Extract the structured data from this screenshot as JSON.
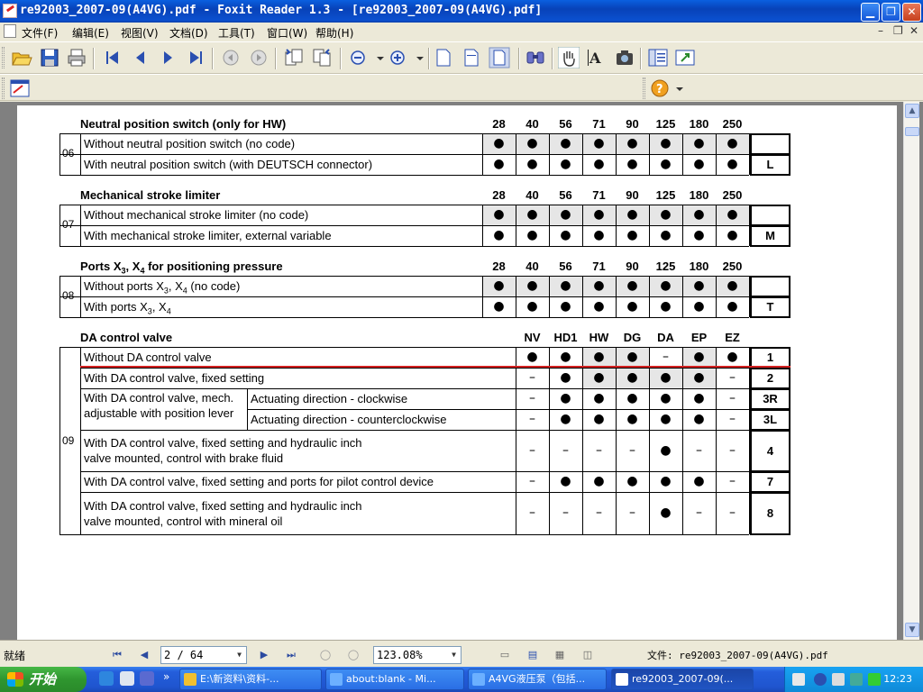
{
  "window": {
    "title": "re92003_2007-09(A4VG).pdf - Foxit Reader 1.3 - [re92003_2007-09(A4VG).pdf]",
    "minimize_glyph": "▁",
    "maximize_glyph": "❐",
    "close_glyph": "✕"
  },
  "menu": {
    "items": [
      "文件(F)",
      "编辑(E)",
      "视图(V)",
      "文档(D)",
      "工具(T)",
      "窗口(W)",
      "帮助(H)"
    ],
    "mdi_buttons": [
      "–",
      "❐",
      "✕"
    ]
  },
  "toolbar": {
    "icons": [
      "open-icon",
      "save-icon",
      "print-icon",
      "first-page-icon",
      "prev-page-icon",
      "next-page-icon",
      "last-page-icon",
      "back-icon",
      "forward-icon",
      "rotate-left-icon",
      "rotate-right-icon",
      "zoom-out-icon",
      "zoom-in-icon",
      "single-page-icon",
      "fit-width-icon",
      "fit-page-icon",
      "find-icon",
      "hand-icon",
      "select-text-icon",
      "snapshot-icon",
      "bookmarks-icon",
      "fullscreen-icon"
    ],
    "help_icon": "help-icon"
  },
  "document": {
    "size_headers": [
      "28",
      "40",
      "56",
      "71",
      "90",
      "125",
      "180",
      "250"
    ],
    "sections": [
      {
        "number": "06",
        "title": "Neutral position switch (only for HW)",
        "rows": [
          {
            "label": "Without neutral position switch (no code)",
            "cells": [
              "●",
              "●",
              "●",
              "●",
              "●",
              "●",
              "●",
              "●"
            ],
            "code": ""
          },
          {
            "label": "With neutral position switch (with DEUTSCH connector)",
            "cells": [
              "●",
              "●",
              "●",
              "●",
              "●",
              "●",
              "●",
              "●"
            ],
            "code": "L"
          }
        ]
      },
      {
        "number": "07",
        "title": "Mechanical stroke limiter",
        "rows": [
          {
            "label": "Without mechanical stroke limiter (no code)",
            "cells": [
              "●",
              "●",
              "●",
              "●",
              "●",
              "●",
              "●",
              "●"
            ],
            "code": ""
          },
          {
            "label": "With mechanical stroke limiter, external variable",
            "cells": [
              "●",
              "●",
              "●",
              "●",
              "●",
              "●",
              "●",
              "●"
            ],
            "code": "M"
          }
        ]
      },
      {
        "number": "08",
        "title_parts": [
          "Ports X",
          "3",
          ", X",
          "4",
          " for positioning pressure"
        ],
        "rows": [
          {
            "label_parts": [
              "Without ports X",
              "3",
              ", X",
              "4",
              " (no code)"
            ],
            "cells": [
              "●",
              "●",
              "●",
              "●",
              "●",
              "●",
              "●",
              "●"
            ],
            "code": ""
          },
          {
            "label_parts": [
              "With ports X",
              "3",
              ", X",
              "4",
              ""
            ],
            "cells": [
              "●",
              "●",
              "●",
              "●",
              "●",
              "●",
              "●",
              "●"
            ],
            "code": "T"
          }
        ]
      },
      {
        "number": "09",
        "title": "DA control valve",
        "col_headers": [
          "NV",
          "HD1",
          "HW",
          "DG",
          "DA",
          "EP",
          "EZ"
        ],
        "rows": [
          {
            "label": "Without DA control valve",
            "cells": [
              "●",
              "●",
              "●",
              "●",
              "–",
              "●",
              "●"
            ],
            "code": "1"
          },
          {
            "label": "With DA control valve, fixed setting",
            "cells": [
              "–",
              "●",
              "●",
              "●",
              "●",
              "●",
              "–"
            ],
            "code": "2"
          },
          {
            "label_line1": "With DA control valve, mech.",
            "label_line2": "adjustable with position lever",
            "sub": "Actuating direction - clockwise",
            "cells": [
              "–",
              "●",
              "●",
              "●",
              "●",
              "●",
              "–"
            ],
            "code": "3R"
          },
          {
            "sub": "Actuating direction - counterclockwise",
            "cells": [
              "–",
              "●",
              "●",
              "●",
              "●",
              "●",
              "–"
            ],
            "code": "3L"
          },
          {
            "label_line1": "With DA control valve, fixed setting and hydraulic inch",
            "label_line2": "valve mounted, control with brake fluid",
            "cells": [
              "–",
              "–",
              "–",
              "–",
              "●",
              "–",
              "–"
            ],
            "code": "4"
          },
          {
            "label": "With DA control valve, fixed setting and ports for pilot control device",
            "cells": [
              "–",
              "●",
              "●",
              "●",
              "●",
              "●",
              "–"
            ],
            "code": "7"
          },
          {
            "label_line1": "With DA control valve, fixed setting and hydraulic inch",
            "label_line2": "valve mounted, control with mineral oil",
            "cells": [
              "–",
              "–",
              "–",
              "–",
              "●",
              "–",
              "–"
            ],
            "code": "8"
          }
        ]
      }
    ],
    "annotation_color": "#d42020"
  },
  "status": {
    "text": "就绪",
    "page": "2 / 64",
    "zoom": "123.08%",
    "file_info": "文件: re92003_2007-09(A4VG).pdf"
  },
  "taskbar": {
    "start_label": "开始",
    "tasks": [
      "E:\\新资料\\资料-...",
      "about:blank - Mi...",
      "A4VG液压泵（包括...",
      "re92003_2007-09(..."
    ],
    "clock": "12:23",
    "overflow_glyph": "»"
  }
}
